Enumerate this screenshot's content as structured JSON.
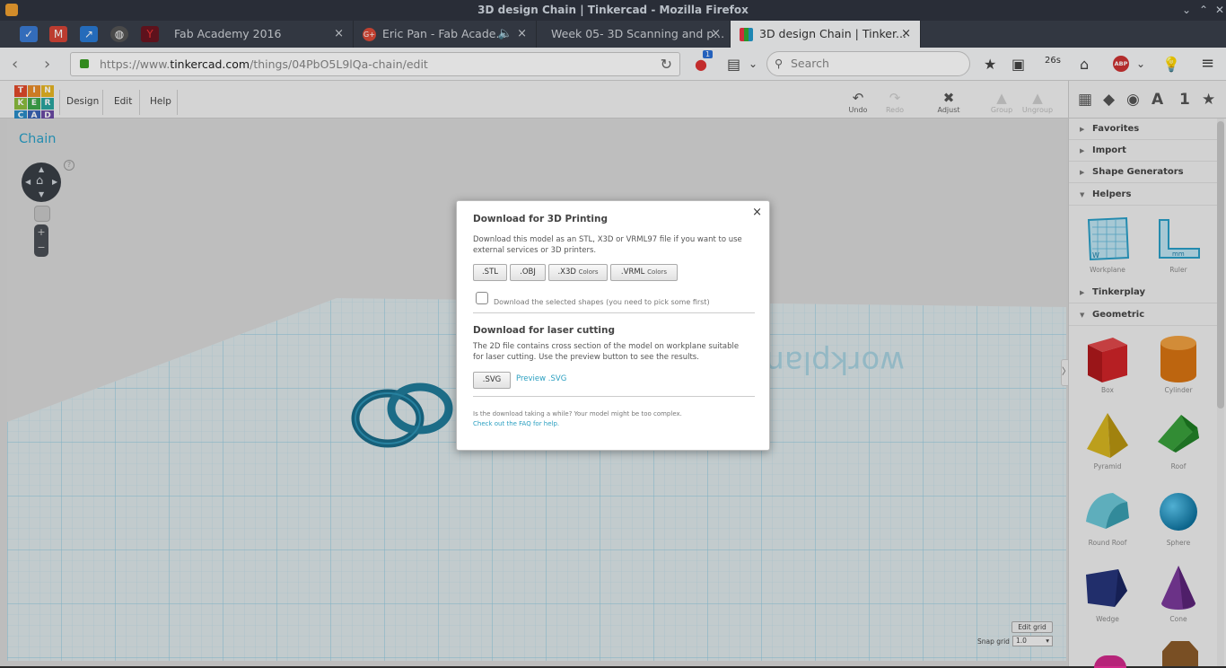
{
  "window": {
    "title": "3D design Chain | Tinkercad - Mozilla Firefox"
  },
  "tabs": [
    {
      "label": "Fab Academy 2016"
    },
    {
      "label": "Eric Pan - Fab Acade..."
    },
    {
      "label": "Week 05- 3D Scanning and p..."
    },
    {
      "label": "3D design Chain | Tinker..."
    }
  ],
  "urlbar": {
    "prefix": "https://www.",
    "domain": "tinkercad.com",
    "path": "/things/04PbO5L9lQa-chain/edit"
  },
  "search": {
    "placeholder": "Search"
  },
  "toolbar": {
    "badge": "1",
    "timer": "26s",
    "abp": "ABP"
  },
  "app": {
    "menu": [
      "Design",
      "Edit",
      "Help"
    ],
    "logo": [
      "T",
      "I",
      "N",
      "K",
      "E",
      "R",
      "C",
      "A",
      "D"
    ],
    "tools": {
      "undo": "Undo",
      "redo": "Redo",
      "adjust": "Adjust",
      "group": "Group",
      "ungroup": "Ungroup"
    },
    "design_title": "Chain",
    "grid": {
      "edit_label": "Edit grid",
      "snap_label": "Snap grid",
      "snap_value": "1.0"
    },
    "sidebar": {
      "top_icons": [
        "A",
        "1",
        "★"
      ],
      "sections": [
        "Favorites",
        "Import",
        "Shape Generators",
        "Helpers",
        "Tinkerplay",
        "Geometric"
      ],
      "helpers": [
        "Workplane",
        "Ruler"
      ],
      "shapes": [
        "Box",
        "Cylinder",
        "Pyramid",
        "Roof",
        "Round Roof",
        "Sphere",
        "Wedge",
        "Cone"
      ]
    }
  },
  "dialog": {
    "title": "Download for 3D Printing",
    "desc": "Download this model as an STL, X3D or VRML97 file if you want to use external services or 3D printers.",
    "buttons": {
      "stl": ".STL",
      "obj": ".OBJ",
      "x3d": ".X3D",
      "vrml": ".VRML",
      "colors": "Colors"
    },
    "checkbox_label": "Download the selected shapes (you need to pick some first)",
    "laser_title": "Download for laser cutting",
    "laser_desc": "The 2D file contains cross section of the model on workplane suitable for laser cutting. Use the preview button to see the results.",
    "svg_button": ".SVG",
    "preview_link": "Preview .SVG",
    "note": "Is the download taking a while? Your model might be too complex.",
    "faq_link": "Check out the FAQ for help.",
    "close": "×"
  },
  "colors": {
    "accent": "#2aa0c8",
    "grid": "#a7d8e8",
    "chain": "#1a6d8a"
  }
}
